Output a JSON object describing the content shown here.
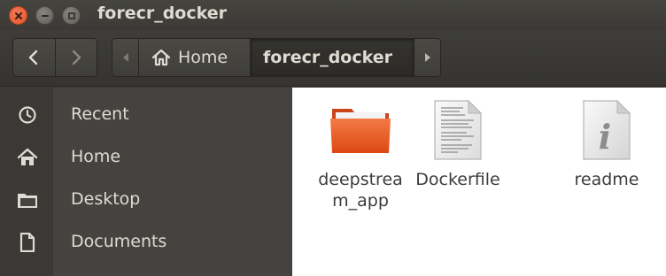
{
  "window": {
    "title": "forecr_docker",
    "controls": [
      "close-icon",
      "minimize-icon",
      "maximize-icon"
    ]
  },
  "toolbar": {
    "back_icon": "chevron-left-icon",
    "forward_icon": "chevron-right-icon",
    "breadcrumb": [
      {
        "label": "Home",
        "icon": "home-icon"
      },
      {
        "label": "forecr_docker",
        "current": true
      }
    ]
  },
  "sidebar": {
    "items": [
      {
        "label": "Recent",
        "icon": "clock-icon"
      },
      {
        "label": "Home",
        "icon": "home-icon"
      },
      {
        "label": "Desktop",
        "icon": "folder-icon"
      },
      {
        "label": "Documents",
        "icon": "document-icon"
      }
    ]
  },
  "files": [
    {
      "name": "deepstream_app",
      "display": "deepstrea\nm_app",
      "type": "folder",
      "color": "#e95420"
    },
    {
      "name": "Dockerfile",
      "display": "Dockerfile",
      "type": "text-file"
    },
    {
      "name": "readme",
      "display": "readme",
      "type": "info-file"
    }
  ]
}
